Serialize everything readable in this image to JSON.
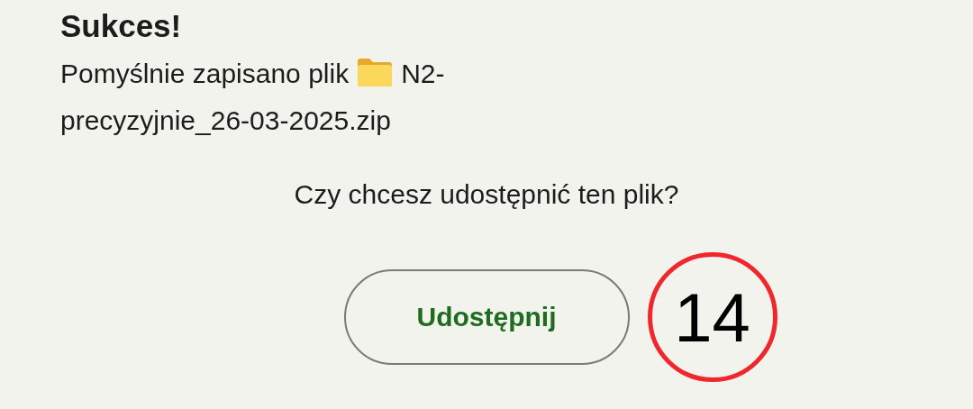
{
  "dialog": {
    "title": "Sukces!",
    "message": {
      "text": "Pomyślnie zapisano plik",
      "file_name_lines": [
        "N2-",
        "precyzyjnie_26-03-2025.zip"
      ]
    },
    "question": "Czy chcesz udostępnić ten plik?",
    "buttons": [
      {
        "label": "Udostępnij"
      }
    ],
    "marker": {
      "label": "14"
    }
  }
}
